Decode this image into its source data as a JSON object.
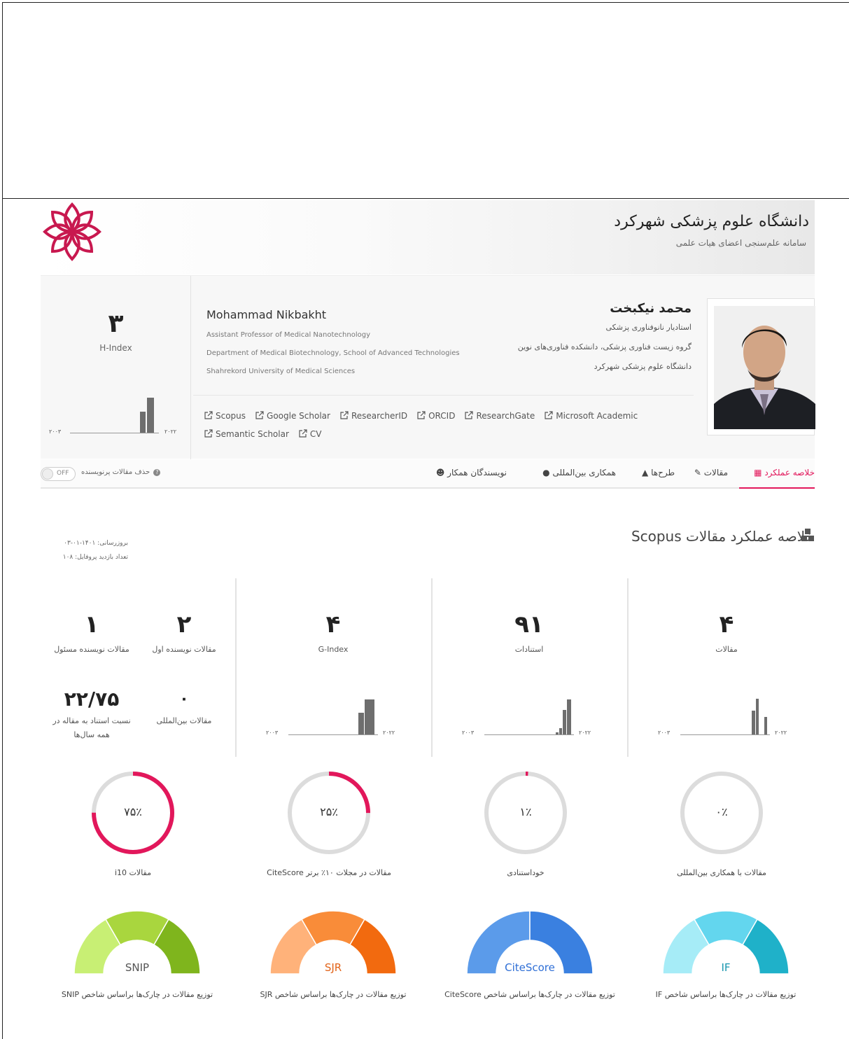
{
  "university": {
    "title": "دانشگاه علوم پزشکی شهرکرد",
    "subtitle": "سامانه علم‌سنجی اعضای هیات علمی"
  },
  "profile": {
    "h_index_value": "۳",
    "h_index_label": "H-Index",
    "spark_start": "۲۰۰۳",
    "spark_end": "۲۰۲۲",
    "name_en": "Mohammad Nikbakht",
    "title_en": "Assistant Professor of Medical Nanotechnology",
    "dept_en": "Department of Medical Biotechnology, School of Advanced Technologies",
    "uni_en": "Shahrekord University of Medical Sciences",
    "name_fa": "محمد نیکبخت",
    "title_fa": "استادیار نانوفناوری پزشکی",
    "dept_fa": "گروه زیست فناوری پزشکی، دانشکده فناوری‌های نوین",
    "uni_fa": "دانشگاه علوم پزشکی شهرکرد",
    "links": [
      "Scopus",
      "Google Scholar",
      "ResearcherID",
      "ORCID",
      "ResearchGate",
      "Microsoft Academic",
      "Semantic Scholar",
      "CV"
    ]
  },
  "tabs": {
    "summary": "خلاصه عملکرد",
    "articles": "مقالات",
    "projects": "طرح‌ها",
    "intl": "همکاری بین‌المللی",
    "coauthors": "نویسندگان همکار",
    "toggle_label": "حذف مقالات پرنویسنده",
    "toggle_state": "OFF"
  },
  "summary": {
    "title": "خلاصه عملکرد مقالات Scopus",
    "updated": "بروزرسانی: ۱۴۰۱-۰۱-۰۳",
    "visits": "تعداد بازدید پروفایل: ۱۰۸",
    "articles_value": "۴",
    "articles_label": "مقالات",
    "citations_value": "۹۱",
    "citations_label": "استنادات",
    "gindex_value": "۴",
    "gindex_label": "G-Index",
    "first_author_value": "۲",
    "first_author_label": "مقالات نویسنده اول",
    "corr_author_value": "۱",
    "corr_author_label": "مقالات نویسنده مسئول",
    "intl_value": "۰",
    "intl_label": "مقالات بین‌المللی",
    "ratio_value": "۲۲/۷۵",
    "ratio_label": "نسبت استناد به مقاله در همه سال‌ها",
    "spark_start": "۲۰۰۳",
    "spark_end": "۲۰۲۲"
  },
  "donuts": [
    {
      "value": "۷۵٪",
      "label": "مقالات i10",
      "pct": 75
    },
    {
      "value": "۲۵٪",
      "label": "مقالات در مجلات ۱۰٪ برتر CiteScore",
      "pct": 25
    },
    {
      "value": "۱٪",
      "label": "خوداستنادی",
      "pct": 1
    },
    {
      "value": "۰٪",
      "label": "مقالات با همکاری بین‌المللی",
      "pct": 0
    }
  ],
  "gauges": [
    {
      "name": "SNIP",
      "label": "توزیع مقالات در چارک‌ها براساس شاخص SNIP",
      "colors": [
        "#c8ef74",
        "#a9d63e",
        "#7fb51d"
      ],
      "text_color": "#555"
    },
    {
      "name": "SJR",
      "label": "توزیع مقالات در چارک‌ها براساس شاخص SJR",
      "colors": [
        "#ffb27a",
        "#f98c39",
        "#f26a0f"
      ],
      "text_color": "#e2641a"
    },
    {
      "name": "CiteScore",
      "label": "توزیع مقالات در چارک‌ها براساس شاخص CiteScore",
      "colors": [
        "#5b9bea",
        "#3a80e0"
      ],
      "text_color": "#2f6fd6"
    },
    {
      "name": "IF",
      "label": "توزیع مقالات در چارک‌ها براساس شاخص IF",
      "colors": [
        "#a6ecf7",
        "#63d6ee",
        "#1fb1c9"
      ],
      "text_color": "#1a97b0"
    }
  ],
  "colors": {
    "accent": "#e2175b",
    "donut_track": "#dcdcdc",
    "bar": "#6e6e6e"
  }
}
